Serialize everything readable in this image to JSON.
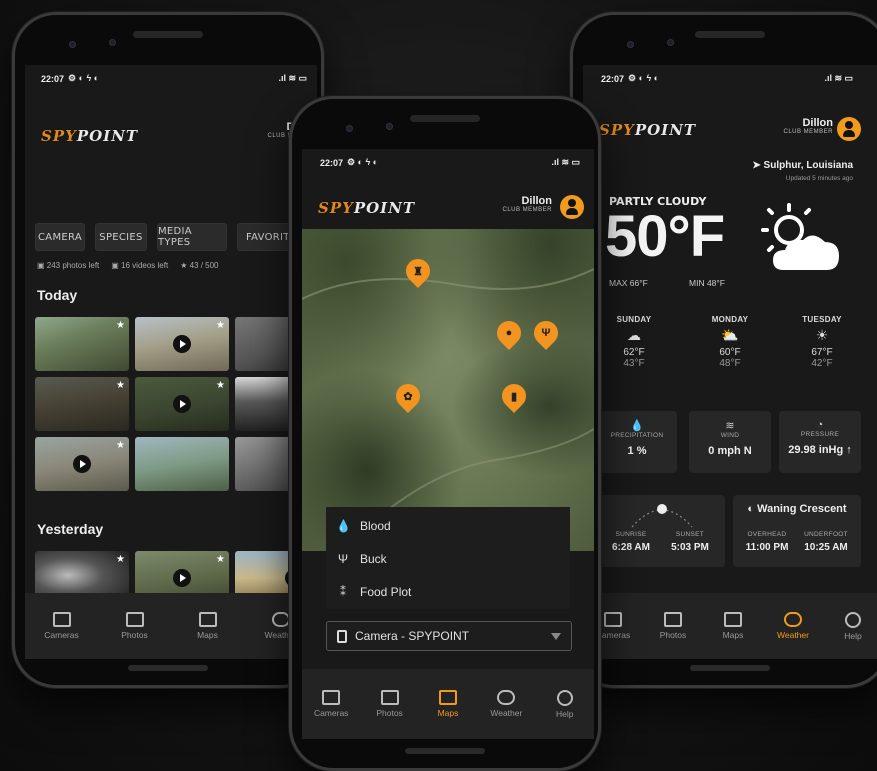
{
  "brand": {
    "logo_a": "SPY",
    "logo_b": "POINT",
    "accent": "#f29a1b"
  },
  "user": {
    "name": "Dillon",
    "role": "CLUB MEMBER"
  },
  "status": {
    "time": "22:07"
  },
  "gallery": {
    "filters": [
      "CAMERA",
      "SPECIES",
      "MEDIA TYPES",
      "FAVORITE"
    ],
    "stats": {
      "photos": "243 photos left",
      "videos": "16 videos left",
      "favorites": "43 / 500"
    },
    "sections": [
      "Today",
      "Yesterday"
    ]
  },
  "map": {
    "legend": [
      {
        "icon": "drop-icon",
        "label": "Blood"
      },
      {
        "icon": "deer-icon",
        "label": "Buck"
      },
      {
        "icon": "wheat-icon",
        "label": "Food Plot"
      }
    ],
    "camera_select": "Camera - SPYPOINT"
  },
  "weather": {
    "location": "Sulphur, Louisiana",
    "updated": "Updated 5 minutes ago",
    "condition": "PARTLY CLOUDY",
    "temp": "50°F",
    "max": "MAX 66°F",
    "min": "MIN 48°F",
    "forecast": [
      {
        "day": "SUNDAY",
        "high": "62°F",
        "low": "43°F"
      },
      {
        "day": "MONDAY",
        "high": "60°F",
        "low": "48°F"
      },
      {
        "day": "TUESDAY",
        "high": "67°F",
        "low": "42°F"
      }
    ],
    "precip": {
      "label": "PRECIPITATION",
      "value": "1 %"
    },
    "wind": {
      "label": "WIND",
      "value": "0 mph N"
    },
    "pressure": {
      "label": "PRESSURE",
      "value": "29.98 inHg ↑"
    },
    "sunrise": {
      "label": "SUNRISE",
      "value": "6:28 AM"
    },
    "sunset": {
      "label": "SUNSET",
      "value": "5:03 PM"
    },
    "moon": {
      "phase": "Waning Crescent",
      "overhead_label": "OVERHEAD",
      "overhead": "11:00 PM",
      "underfoot_label": "UNDERFOOT",
      "underfoot": "10:25 AM"
    }
  },
  "nav": {
    "cameras": "Cameras",
    "photos": "Photos",
    "maps": "Maps",
    "weather": "Weather",
    "help": "Help"
  }
}
